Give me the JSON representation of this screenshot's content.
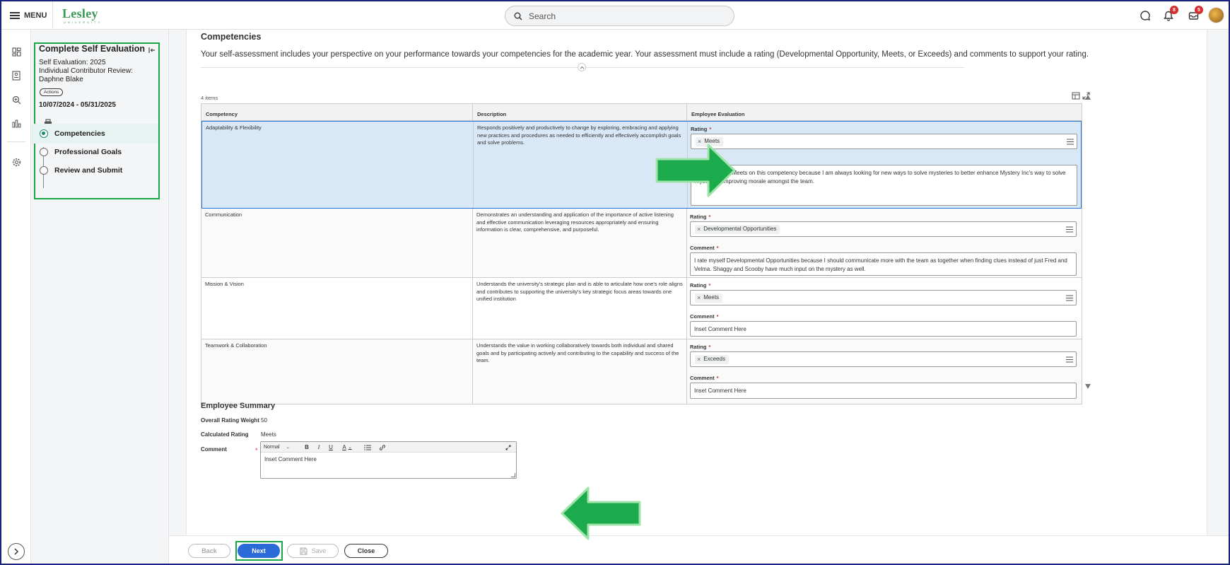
{
  "topbar": {
    "menu_label": "MENU",
    "logo_text": "Lesley",
    "logo_subtext": "UNIVERSITY",
    "search_placeholder": "Search",
    "notifications_count": "8",
    "inbox_count": "5"
  },
  "task": {
    "title": "Complete Self Evaluation",
    "line1": "Self Evaluation: 2025",
    "line2": "Individual Contributor Review:",
    "line3": "Daphne Blake",
    "actions_label": "Actions",
    "dates": "10/07/2024 - 05/31/2025",
    "steps": [
      {
        "label": "Competencies",
        "active": true
      },
      {
        "label": "Professional Goals",
        "active": false
      },
      {
        "label": "Review and Submit",
        "active": false
      }
    ]
  },
  "section": {
    "title": "Competencies",
    "description": "Your self-assessment includes your perspective on your performance towards your competencies for the academic year. Your assessment must include a rating (Developmental Opportunity, Meets, or Exceeds) and comments to support your rating.",
    "items_count": "4 items"
  },
  "table": {
    "headers": [
      "Competency",
      "Description",
      "Employee Evaluation"
    ],
    "rating_label": "Rating",
    "comment_label": "Comment",
    "rows": [
      {
        "competency": "Adaptability & Flexibility",
        "description": "Responds positively and productively to change by exploring, embracing and applying new practices and procedures as needed to efficiently and effectively accomplish goals and solve problems.",
        "rating": "Meets",
        "comment": "I rate myself a Meets on this competency because I am always looking for new ways to solve mysteries to better enhance Mystery Inc's way to solve mysteries. Improving morale amongst the team."
      },
      {
        "competency": "Communication",
        "description": "Demonstrates an understanding and application of the importance of active listening and effective communication leveraging resources appropriately and ensuring information is clear, comprehensive, and purposeful.",
        "rating": "Developmental Opportunities",
        "comment": "I rate myself Developmental Opportunities because I should communicate more with the team as together when finding clues instead of just Fred and Velma. Shaggy and Scooby have much input on the mystery as well."
      },
      {
        "competency": "Mission & Vision",
        "description": "Understands the university's strategic plan and is able to articulate how one's role aligns and contributes to supporting the university's key strategic focus areas towards one unified institution",
        "rating": "Meets",
        "comment": "Inset Comment Here"
      },
      {
        "competency": "Teamwork & Collaboration",
        "description": "Understands the value in working collaboratively towards both individual and shared goals and by participating actively and contributing to the capability and success of the team.",
        "rating": "Exceeds",
        "comment": "Inset Comment Here"
      }
    ]
  },
  "summary": {
    "title": "Employee Summary",
    "weight_label": "Overall Rating Weight",
    "weight_value": "50",
    "calc_label": "Calculated Rating",
    "calc_value": "Meets",
    "comment_label": "Comment",
    "editor_style": "Normal",
    "comment_text": "Inset Comment Here"
  },
  "footer": {
    "back": "Back",
    "next": "Next",
    "save": "Save",
    "close": "Close"
  },
  "colors": {
    "brand_green": "#3a9a55",
    "highlight_green": "#19a64a",
    "primary_blue": "#2b6bd8",
    "selected_row": "#d9e8f7",
    "required_red": "#d32f2f"
  }
}
